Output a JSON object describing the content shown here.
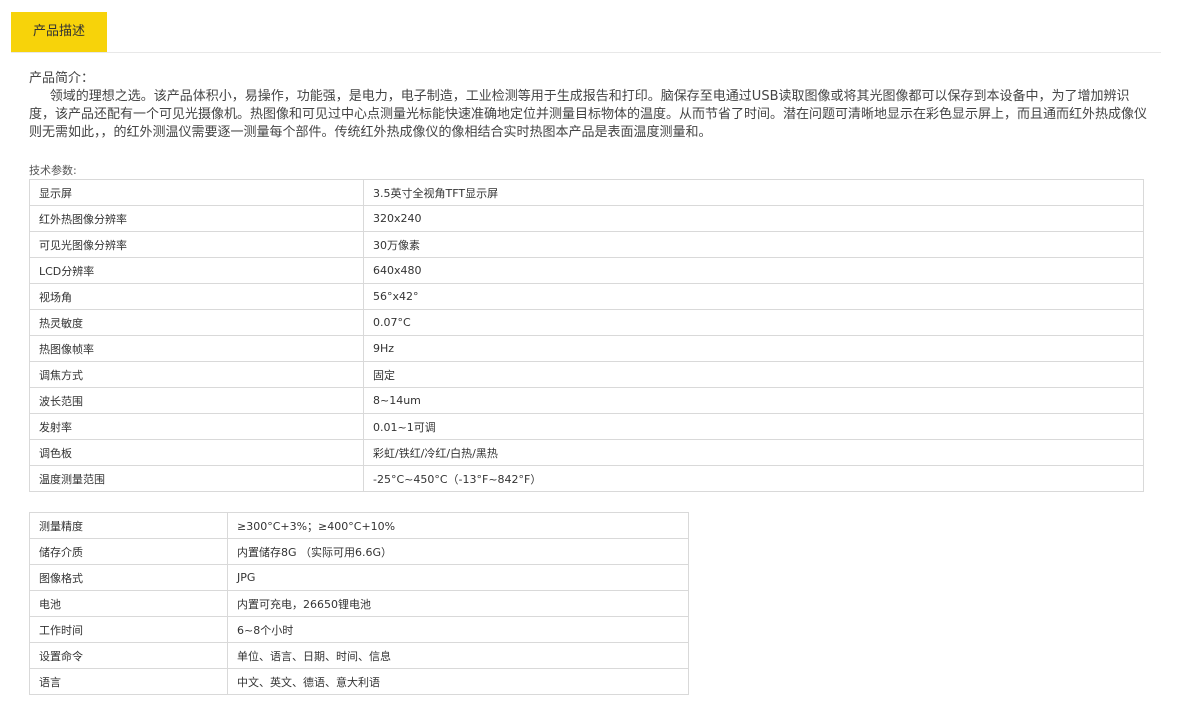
{
  "tabs": {
    "active_label": "产品描述"
  },
  "intro": {
    "heading": "产品简介：",
    "paragraph": "领域的理想之选。该产品体积小，易操作，功能强，是电力，电子制造，工业检测等用于生成报告和打印。脑保存至电通过USB读取图像或将其光图像都可以保存到本设备中，为了增加辨识度，该产品还配有一个可见光摄像机。热图像和可见过中心点测量光标能快速准确地定位并测量目标物体的温度。从而节省了时间。潜在问题可清晰地显示在彩色显示屏上，而且通而红外热成像仪则无需如此，，的红外测温仪需要逐一测量每个部件。传统红外热成像仪的像相结合实时热图本产品是表面温度测量和。"
  },
  "spec_label": "技术参数:",
  "table1": [
    {
      "key": "显示屏",
      "value": "3.5英寸全视角TFT显示屏"
    },
    {
      "key": "红外热图像分辨率",
      "value": "320x240"
    },
    {
      "key": "可见光图像分辨率",
      "value": "30万像素"
    },
    {
      "key": "LCD分辨率",
      "value": "640x480"
    },
    {
      "key": "视场角",
      "value": "56°x42°"
    },
    {
      "key": "热灵敏度",
      "value": "0.07°C"
    },
    {
      "key": "热图像帧率",
      "value": "9Hz"
    },
    {
      "key": "调焦方式",
      "value": "固定"
    },
    {
      "key": "波长范围",
      "value": "8~14um"
    },
    {
      "key": "发射率",
      "value": "0.01~1可调"
    },
    {
      "key": "调色板",
      "value": "彩虹/铁红/冷红/白热/黑热"
    },
    {
      "key": "温度测量范围",
      "value": "-25°C~450°C（-13°F~842°F）"
    }
  ],
  "table2": [
    {
      "key": "测量精度",
      "value": "≥300°C+3%；≥400°C+10%"
    },
    {
      "key": "储存介质",
      "value": "内置储存8G （实际可用6.6G）"
    },
    {
      "key": "图像格式",
      "value": "JPG"
    },
    {
      "key": "电池",
      "value": "内置可充电，26650锂电池"
    },
    {
      "key": "工作时间",
      "value": "6~8个小时"
    },
    {
      "key": "设置命令",
      "value": "单位、语言、日期、时间、信息"
    },
    {
      "key": "语言",
      "value": "中文、英文、德语、意大利语"
    }
  ]
}
